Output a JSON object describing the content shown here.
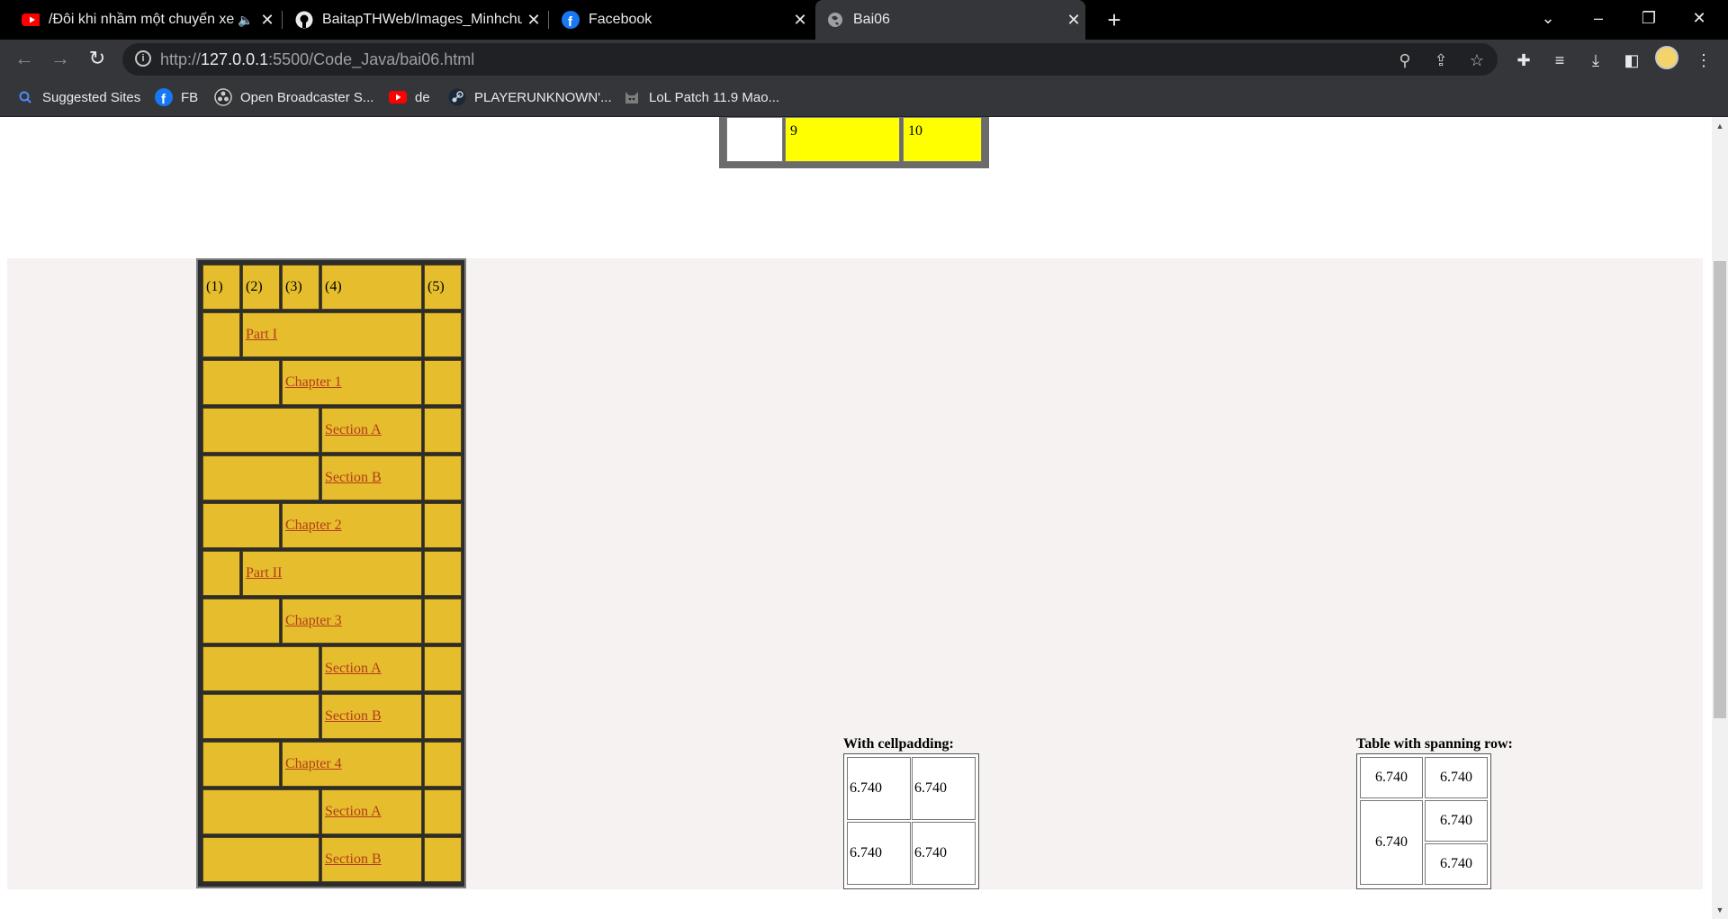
{
  "tabs": [
    {
      "title": "/Đôi khi nhầm một chuyến xe",
      "has_audio": true
    },
    {
      "title": "BaitapTHWeb/Images_Minhchung"
    },
    {
      "title": "Facebook"
    },
    {
      "title": "Bai06",
      "active": true
    }
  ],
  "address": {
    "scheme": "http://",
    "host": "127.0.0.1",
    "path": ":5500/Code_Java/bai06.html"
  },
  "bookmarks": [
    {
      "label": "Suggested Sites",
      "icon": "search-icon"
    },
    {
      "label": "FB",
      "icon": "facebook-icon"
    },
    {
      "label": "Open Broadcaster S...",
      "icon": "obs-icon"
    },
    {
      "label": "de",
      "icon": "youtube-icon"
    },
    {
      "label": "PLAYERUNKNOWN'...",
      "icon": "steam-icon"
    },
    {
      "label": "LoL Patch 11.9 Mao...",
      "icon": "cat-icon"
    }
  ],
  "top_table": {
    "cells": [
      "",
      "9",
      "10"
    ]
  },
  "toc": {
    "headers": [
      "(1)",
      "(2)",
      "(3)",
      "(4)",
      "(5)"
    ],
    "rows": [
      {
        "label": "Part I",
        "level": 1
      },
      {
        "label": "Chapter 1",
        "level": 2
      },
      {
        "label": "Section A",
        "level": 3
      },
      {
        "label": "Section B",
        "level": 3
      },
      {
        "label": "Chapter 2",
        "level": 2
      },
      {
        "label": "Part II",
        "level": 1
      },
      {
        "label": "Chapter 3",
        "level": 2
      },
      {
        "label": "Section A",
        "level": 3
      },
      {
        "label": "Section B",
        "level": 3
      },
      {
        "label": "Chapter 4",
        "level": 2
      },
      {
        "label": "Section A",
        "level": 3
      },
      {
        "label": "Section B",
        "level": 3
      }
    ]
  },
  "cellpadding_table": {
    "caption": "With cellpadding:",
    "cells": [
      "6.740",
      "6.740",
      "6.740",
      "6.740"
    ]
  },
  "spanning_table": {
    "caption": "Table with spanning row:",
    "cells": [
      "6.740",
      "6.740",
      "6.740",
      "6.740",
      "6.740"
    ]
  },
  "colors": {
    "toc_cell": "#e6be2d",
    "toc_link": "#b53a1c",
    "highlight_yellow": "#ffff00",
    "band": "#f5f2f1"
  }
}
